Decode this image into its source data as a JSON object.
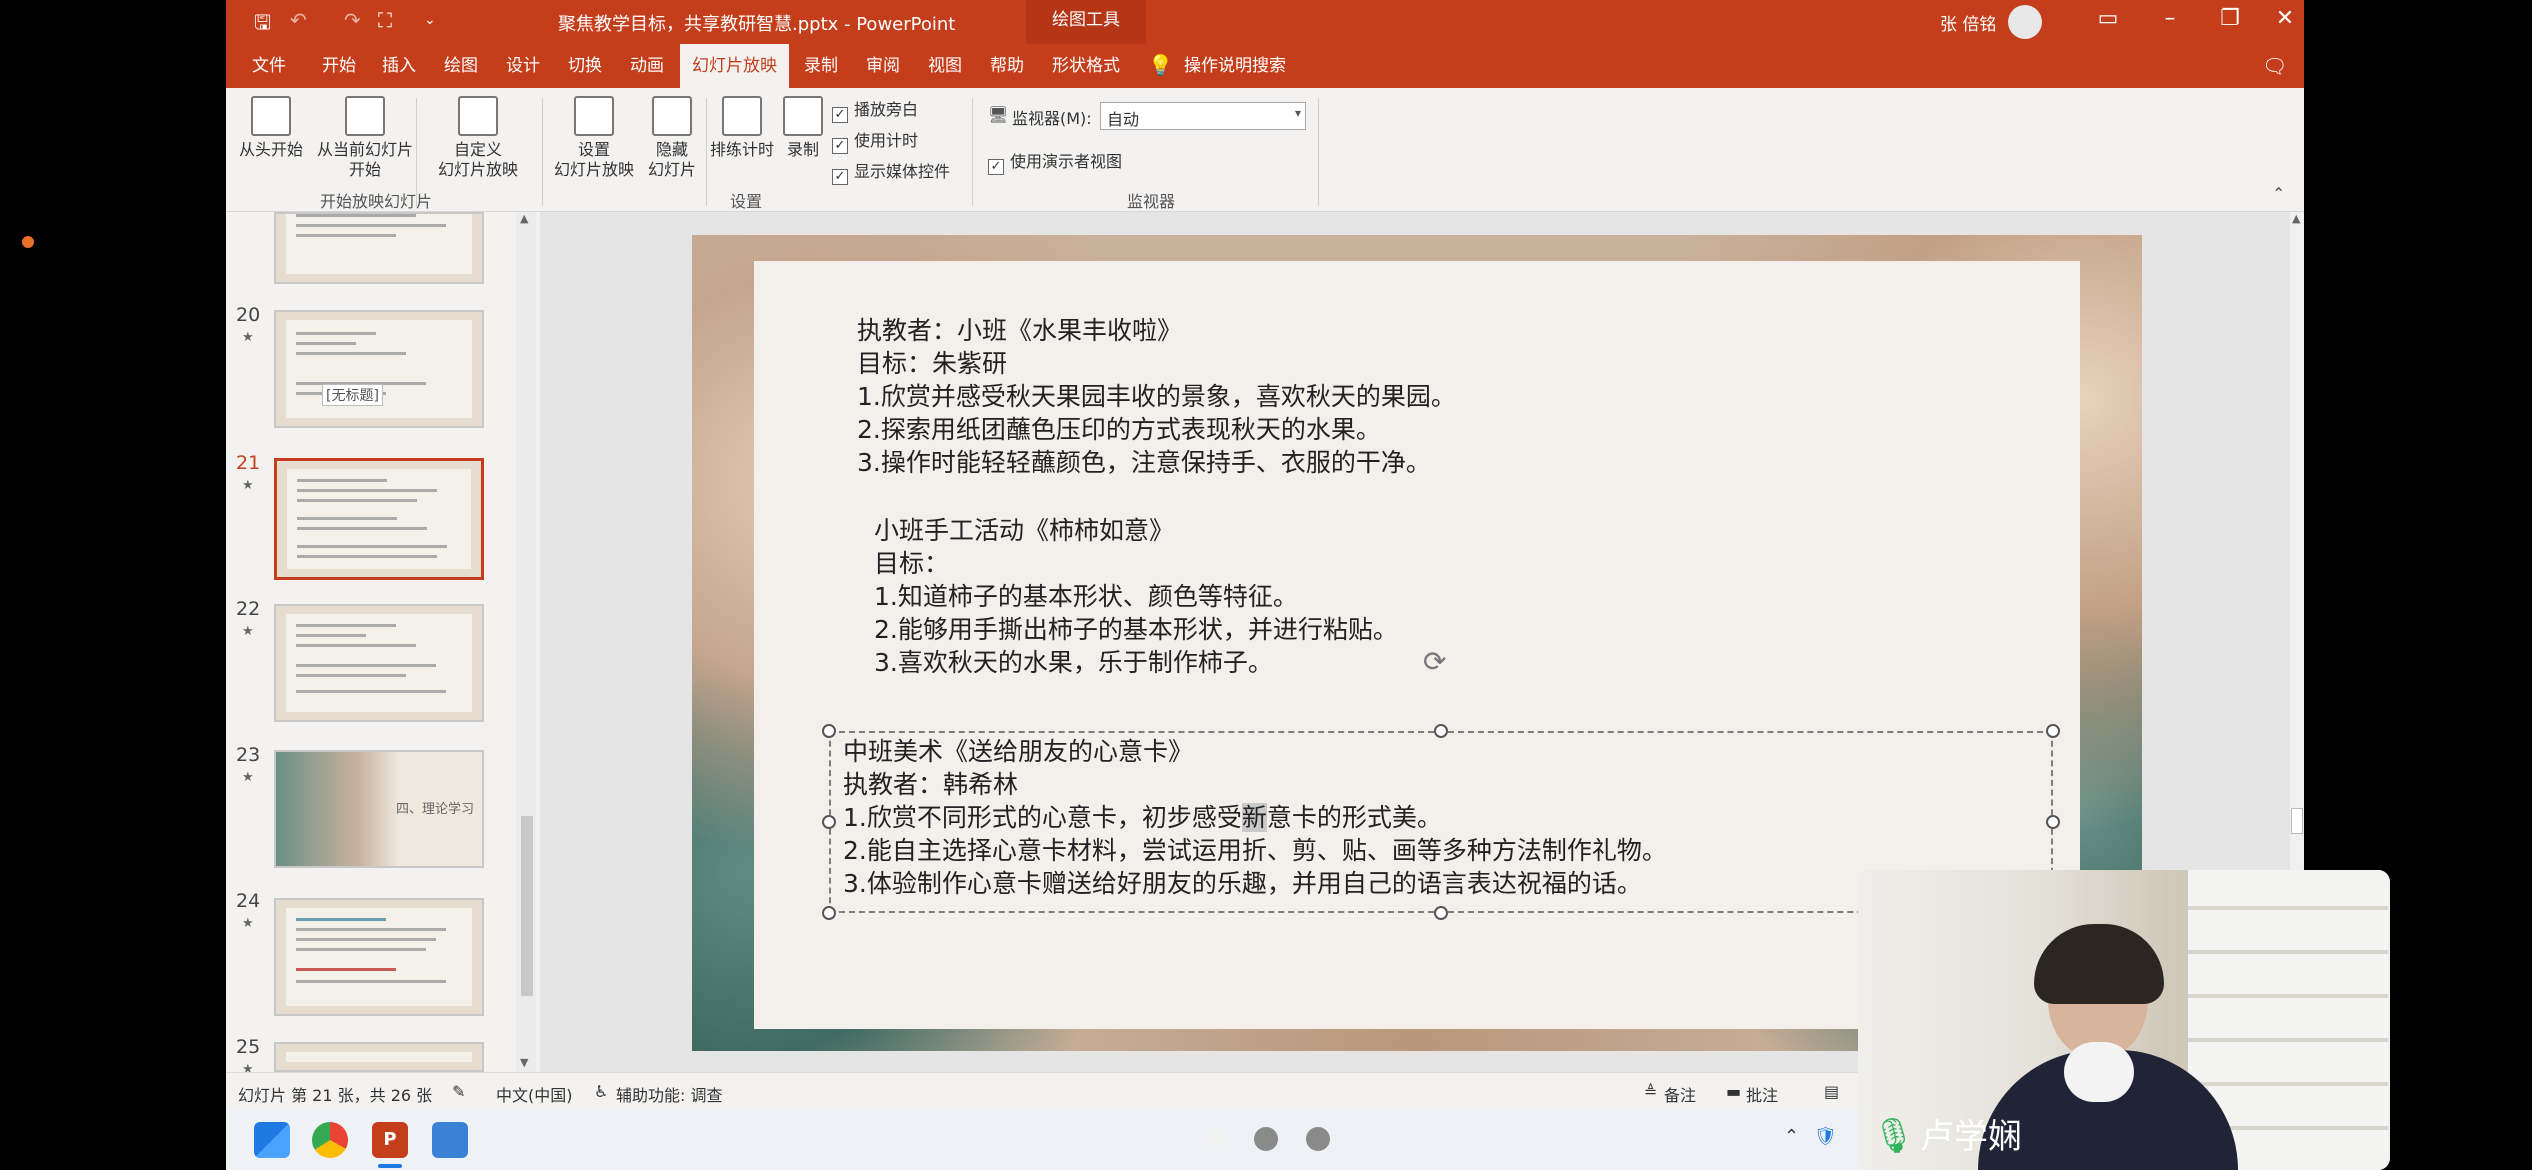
{
  "app": {
    "title": "聚焦教学目标，共享教研智慧.pptx - PowerPoint",
    "context_tab": "绘图工具",
    "user": "张 倍铭",
    "accent": "#c43e1c"
  },
  "menu": {
    "tabs": [
      "文件",
      "开始",
      "插入",
      "绘图",
      "设计",
      "切换",
      "动画",
      "幻灯片放映",
      "录制",
      "审阅",
      "视图",
      "帮助",
      "形状格式"
    ],
    "active_tab": "幻灯片放映",
    "search_label": "操作说明搜索"
  },
  "ribbon": {
    "from_start": "从头开始",
    "from_current_1": "从当前幻灯片",
    "from_current_2": "开始",
    "custom_1": "自定义",
    "custom_2": "幻灯片放映",
    "group_start": "开始放映幻灯片",
    "setup_1": "设置",
    "setup_2": "幻灯片放映",
    "hide_1": "隐藏",
    "hide_2": "幻灯片",
    "rehearse": "排练计时",
    "record": "录制",
    "chk_narration": "播放旁白",
    "chk_timing": "使用计时",
    "chk_media": "显示媒体控件",
    "group_setup": "设置",
    "monitor_label": "监视器(M):",
    "monitor_value": "自动",
    "chk_presenter": "使用演示者视图",
    "group_monitor": "监视器"
  },
  "thumbs": {
    "nums": [
      "20",
      "21",
      "22",
      "23",
      "24",
      "25"
    ],
    "tooltip": "[无标题]",
    "slide23_text": "四、理论学习"
  },
  "slide": {
    "block1": [
      "执教者：小班《水果丰收啦》",
      "目标：朱紫研",
      "1.欣赏并感受秋天果园丰收的景象，喜欢秋天的果园。",
      "2.探索用纸团蘸色压印的方式表现秋天的水果。",
      "3.操作时能轻轻蘸颜色，注意保持手、衣服的干净。"
    ],
    "block2": [
      "小班手工活动《柿柿如意》",
      "目标：",
      "1.知道柿子的基本形状、颜色等特征。",
      "2.能够用手撕出柿子的基本形状，并进行粘贴。",
      "3.喜欢秋天的水果，乐于制作柿子。"
    ],
    "block3": {
      "title": "中班美术《送给朋友的心意卡》",
      "teacher": "执教者：韩希林",
      "line1_pre": "1.欣赏不同形式的心意卡，初步感受",
      "line1_hl": "新",
      "line1_post": "意卡的形式美。",
      "line2": "2.能自主选择心意卡材料，尝试运用折、剪、贴、画等多种方法制作礼物。",
      "line3": "3.体验制作心意卡赠送给好朋友的乐趣，并用自己的语言表达祝福的话。"
    }
  },
  "status": {
    "slide_info": "幻灯片 第 21 张，共 26 张",
    "language": "中文(中国)",
    "accessibility": "辅助功能: 调查",
    "notes": "备注",
    "comments": "批注"
  },
  "webcam": {
    "name": "卢学娴"
  }
}
